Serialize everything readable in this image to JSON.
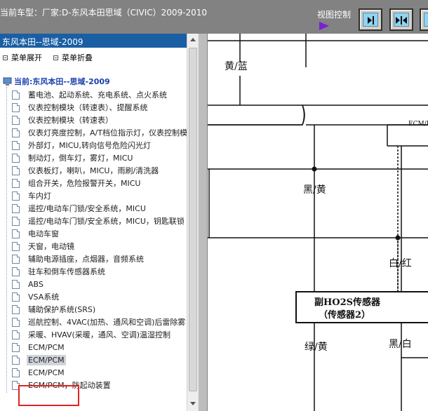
{
  "topbar": {
    "title": "当前车型：厂家:D-东风本田思域（CIVIC）2009-2010",
    "view_control_label": "视图控制"
  },
  "left_pane": {
    "header": "东风本田--思域-2009",
    "menu": {
      "expand_label": "菜单展开",
      "collapse_label": "菜单折叠"
    },
    "tree_root": "当前:东风本田--思域-2009",
    "items": [
      "蓄电池、起动系统、充电系统、点火系统",
      "仪表控制模块（转速表）、提醒系统",
      "仪表控制模块（转速表）",
      "仪表灯亮度控制，A/T档位指示灯，仪表控制模",
      "外部灯，MICU,转向信号危险闪光灯",
      "制动灯，倒车灯，雾灯，MICU",
      "仪表板灯，喇叭，MICU，雨刷/清洗器",
      "组合开关，危险报警开关，MICU",
      "车内灯",
      "遥控/电动车门锁/安全系统，MICU",
      "遥控/电动车门锁/安全系统，MICU，钥匙联锁",
      "电动车窗",
      "天窗，电动镜",
      "辅助电源插座，点烟器，音频系统",
      "驻车和倒车传感器系统",
      "ABS",
      "VSA系统",
      "辅助保护系统(SRS)",
      "巡航控制、4VAC(加热、通风和空调)后雷除雾",
      "采暖、HVAV(采暖，通风、空调)温湿控制",
      "ECM/PCM",
      "ECM/PCM",
      "ECM/PCM",
      "ECM/PCM，防起动装置"
    ],
    "selected_index": 21
  },
  "diagram": {
    "labels": {
      "yellow_blue": "黄/蓝",
      "black_yellow": "黑/黄",
      "white_red": "白/红",
      "green_yellow": "绿/黄",
      "black_white": "黑/白",
      "ecm": "ECM/P"
    },
    "sensor_line1": "副HO2S传感器",
    "sensor_line2": "（传感器2）"
  },
  "colors": {
    "topbar_bg": "#828282",
    "header_bg": "#1a5fa3",
    "highlight": "#e02424",
    "play_arrow": "#7a1fd8",
    "button_face": "#8fd4f2"
  }
}
